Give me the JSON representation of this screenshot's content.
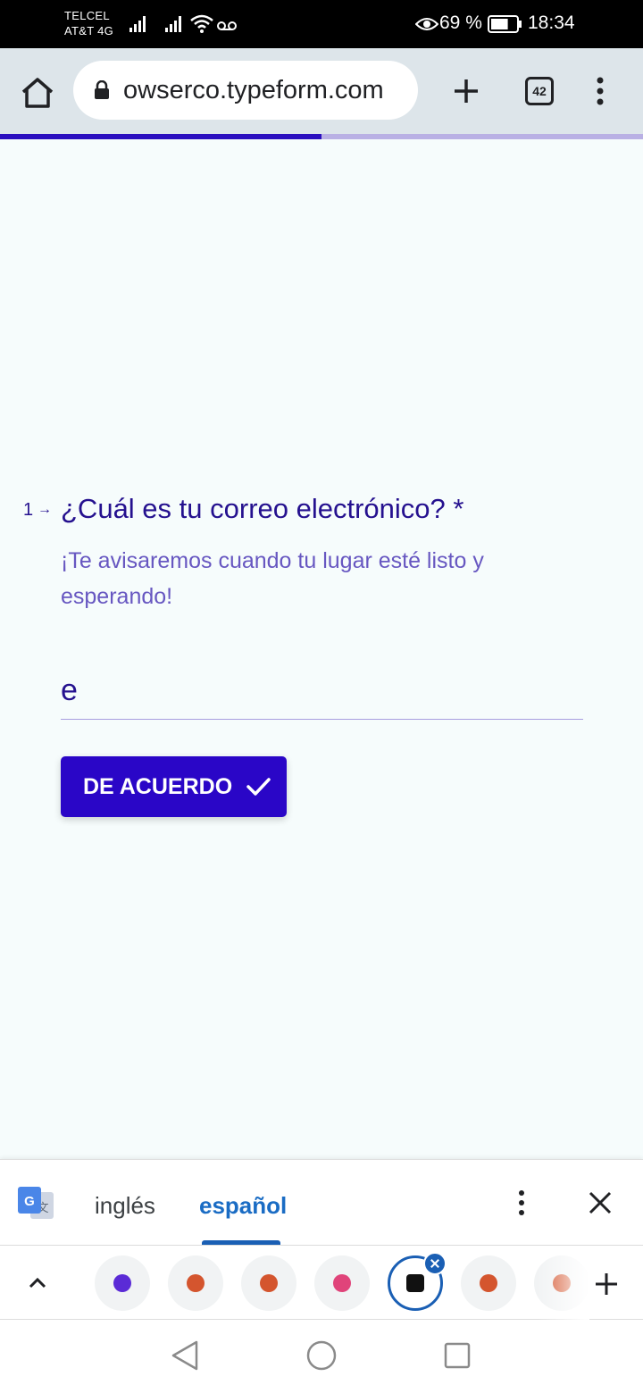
{
  "status_bar": {
    "carrier_1": "TELCEL",
    "carrier_2": "AT&T 4G",
    "battery_percent": "69 %",
    "time": "18:34",
    "battery_level": 0.69
  },
  "browser": {
    "url": "owserco.typeform.com",
    "tab_count": "42",
    "icons": [
      "home-icon",
      "lock-icon",
      "plus-icon",
      "tabs-icon",
      "more-vert-icon"
    ]
  },
  "form": {
    "progress": 0.5,
    "question_number": "1",
    "question_arrow": "→",
    "question_text": "¿Cuál es tu correo electrónico? *",
    "description": "¡Te avisaremos cuando tu lugar esté listo y esperando!",
    "answer_value": "e",
    "submit_label": "DE ACUERDO",
    "accent_color": "#2a06c7"
  },
  "translate_bar": {
    "source_language": "inglés",
    "target_language": "español",
    "icons": [
      "google-translate-icon",
      "more-vert-icon",
      "close-icon"
    ]
  },
  "tab_strip": {
    "tabs": [
      {
        "icon": "tab-favicon-purple",
        "color": "#5b2bd6"
      },
      {
        "icon": "tab-favicon-p",
        "color": "#d4552e"
      },
      {
        "icon": "tab-favicon-p",
        "color": "#d4552e"
      },
      {
        "icon": "tab-favicon-a",
        "color": "#e0447a"
      },
      {
        "icon": "tab-favicon-dark",
        "color": "#111111",
        "active": true
      },
      {
        "icon": "tab-favicon-p",
        "color": "#d4552e"
      },
      {
        "icon": "tab-favicon-p",
        "color": "#d4552e"
      }
    ]
  },
  "nav_bar": {
    "icons": [
      "back-icon",
      "home-circle-icon",
      "recents-icon"
    ]
  }
}
